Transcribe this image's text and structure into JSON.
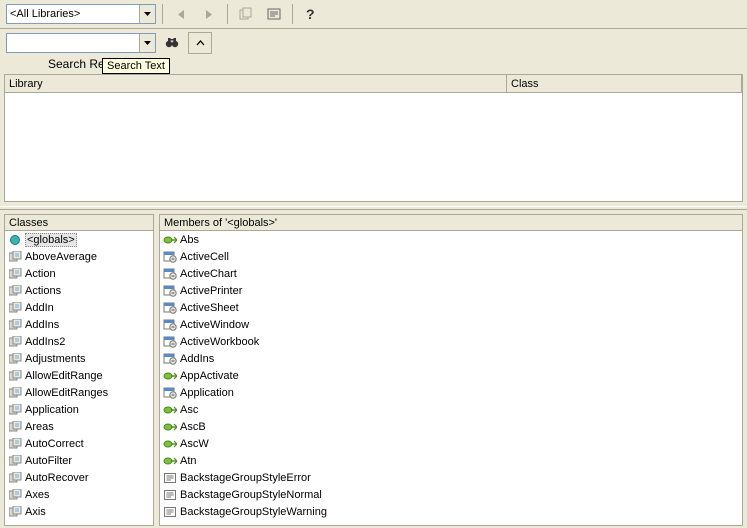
{
  "toolbar": {
    "library_combo": "<All Libraries>",
    "search_value": ""
  },
  "search": {
    "results_label": "Search Results",
    "tooltip": "Search Text",
    "col_library": "Library",
    "col_class": "Class"
  },
  "classes": {
    "heading": "Classes",
    "items": [
      {
        "label": "<globals>",
        "icon": "globals"
      },
      {
        "label": "AboveAverage",
        "icon": "class"
      },
      {
        "label": "Action",
        "icon": "class"
      },
      {
        "label": "Actions",
        "icon": "class"
      },
      {
        "label": "AddIn",
        "icon": "class"
      },
      {
        "label": "AddIns",
        "icon": "class"
      },
      {
        "label": "AddIns2",
        "icon": "class"
      },
      {
        "label": "Adjustments",
        "icon": "class"
      },
      {
        "label": "AllowEditRange",
        "icon": "class"
      },
      {
        "label": "AllowEditRanges",
        "icon": "class"
      },
      {
        "label": "Application",
        "icon": "class"
      },
      {
        "label": "Areas",
        "icon": "class"
      },
      {
        "label": "AutoCorrect",
        "icon": "class"
      },
      {
        "label": "AutoFilter",
        "icon": "class"
      },
      {
        "label": "AutoRecover",
        "icon": "class"
      },
      {
        "label": "Axes",
        "icon": "class"
      },
      {
        "label": "Axis",
        "icon": "class"
      }
    ]
  },
  "members": {
    "heading": "Members of '<globals>'",
    "items": [
      {
        "label": "Abs",
        "icon": "method"
      },
      {
        "label": "ActiveCell",
        "icon": "property"
      },
      {
        "label": "ActiveChart",
        "icon": "property"
      },
      {
        "label": "ActivePrinter",
        "icon": "property"
      },
      {
        "label": "ActiveSheet",
        "icon": "property"
      },
      {
        "label": "ActiveWindow",
        "icon": "property"
      },
      {
        "label": "ActiveWorkbook",
        "icon": "property"
      },
      {
        "label": "AddIns",
        "icon": "property"
      },
      {
        "label": "AppActivate",
        "icon": "method"
      },
      {
        "label": "Application",
        "icon": "property"
      },
      {
        "label": "Asc",
        "icon": "method"
      },
      {
        "label": "AscB",
        "icon": "method"
      },
      {
        "label": "AscW",
        "icon": "method"
      },
      {
        "label": "Atn",
        "icon": "method"
      },
      {
        "label": "BackstageGroupStyleError",
        "icon": "const"
      },
      {
        "label": "BackstageGroupStyleNormal",
        "icon": "const"
      },
      {
        "label": "BackstageGroupStyleWarning",
        "icon": "const"
      }
    ]
  }
}
